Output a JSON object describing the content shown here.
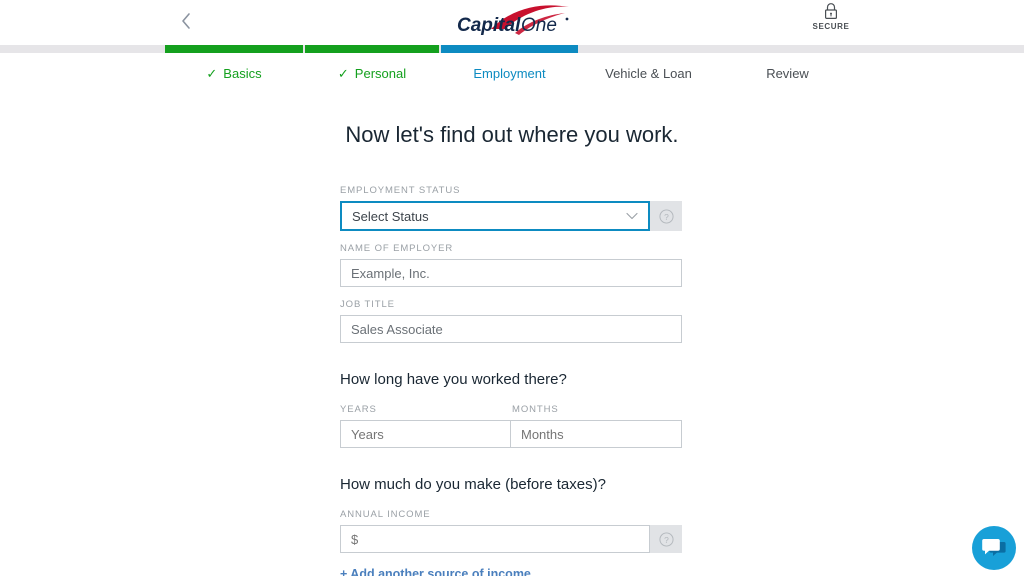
{
  "header": {
    "back_icon": "chevron-left-icon",
    "logo_text_1": "Capital",
    "logo_text_2": "One",
    "secure_label": "SECURE",
    "lock_icon": "lock-icon"
  },
  "progress": {
    "steps": [
      {
        "label": "Basics",
        "state": "done",
        "color": "#14a01e"
      },
      {
        "label": "Personal",
        "state": "done",
        "color": "#14a01e"
      },
      {
        "label": "Employment",
        "state": "active",
        "color": "#0d8bc1"
      },
      {
        "label": "Vehicle & Loan",
        "state": "todo",
        "color": "#e6e5e8"
      },
      {
        "label": "Review",
        "state": "todo",
        "color": "#e6e5e8"
      }
    ],
    "check_glyph": "✓"
  },
  "main": {
    "title": "Now let's find out where you work.",
    "employment_status": {
      "label": "EMPLOYMENT STATUS",
      "value": "Select Status",
      "chevron_icon": "chevron-down-icon",
      "help_icon": "question-circle-icon"
    },
    "employer": {
      "label": "NAME OF EMPLOYER",
      "placeholder": "Example, Inc.",
      "value": ""
    },
    "job_title": {
      "label": "JOB TITLE",
      "placeholder": "Sales Associate",
      "value": ""
    },
    "duration": {
      "question": "How long have you worked there?",
      "years_label": "YEARS",
      "years_placeholder": "Years",
      "years_value": "",
      "months_label": "MONTHS",
      "months_placeholder": "Months",
      "months_value": ""
    },
    "income": {
      "question": "How much do you make (before taxes)?",
      "label": "ANNUAL INCOME",
      "placeholder": "$",
      "value": "",
      "help_icon": "question-circle-icon",
      "add_link": "+ Add another source of income"
    }
  },
  "chat": {
    "icon": "chat-bubble-icon"
  }
}
